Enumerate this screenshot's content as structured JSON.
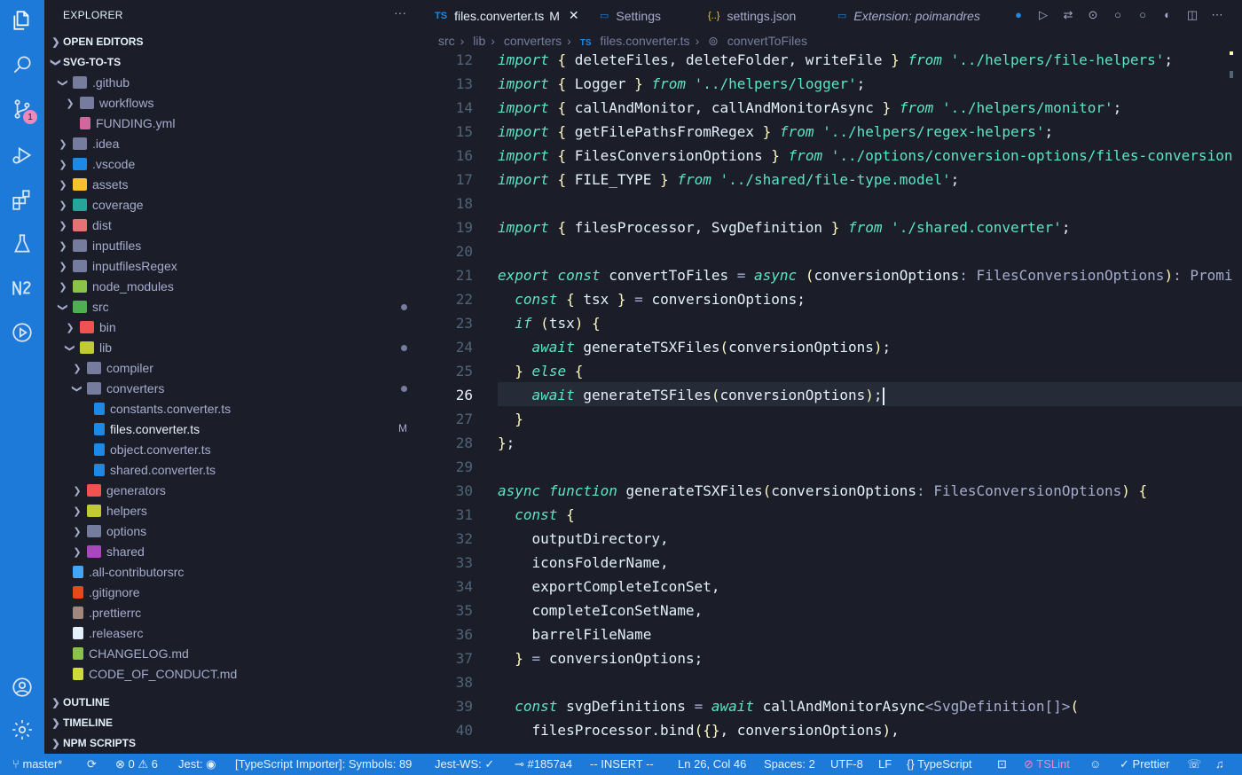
{
  "sidebar": {
    "title": "EXPLORER",
    "more": "···",
    "sections": {
      "open_editors": "OPEN EDITORS",
      "project": "SVG-TO-TS",
      "outline": "OUTLINE",
      "timeline": "TIMELINE",
      "npm": "NPM SCRIPTS"
    },
    "tree": [
      {
        "label": ".github",
        "depth": 1,
        "expanded": true,
        "color": "#767c9d"
      },
      {
        "label": "workflows",
        "depth": 2,
        "expanded": false,
        "color": "#767c9d"
      },
      {
        "label": "FUNDING.yml",
        "depth": 2,
        "file": true,
        "color": "#d0679d"
      },
      {
        "label": ".idea",
        "depth": 1,
        "expanded": false,
        "color": "#767c9d"
      },
      {
        "label": ".vscode",
        "depth": 1,
        "expanded": false,
        "color": "#1e88e5"
      },
      {
        "label": "assets",
        "depth": 1,
        "expanded": false,
        "color": "#fbc02d"
      },
      {
        "label": "coverage",
        "depth": 1,
        "expanded": false,
        "color": "#26a69a"
      },
      {
        "label": "dist",
        "depth": 1,
        "expanded": false,
        "color": "#e57373"
      },
      {
        "label": "inputfiles",
        "depth": 1,
        "expanded": false,
        "color": "#767c9d"
      },
      {
        "label": "inputfilesRegex",
        "depth": 1,
        "expanded": false,
        "color": "#767c9d"
      },
      {
        "label": "node_modules",
        "depth": 1,
        "expanded": false,
        "color": "#8bc34a"
      },
      {
        "label": "src",
        "depth": 1,
        "expanded": true,
        "color": "#4caf50",
        "dot": true
      },
      {
        "label": "bin",
        "depth": 2,
        "expanded": false,
        "color": "#ef5350"
      },
      {
        "label": "lib",
        "depth": 2,
        "expanded": true,
        "color": "#c0ca33",
        "dot": true
      },
      {
        "label": "compiler",
        "depth": 3,
        "expanded": false,
        "color": "#767c9d"
      },
      {
        "label": "converters",
        "depth": 3,
        "expanded": true,
        "color": "#767c9d",
        "dot": true
      },
      {
        "label": "constants.converter.ts",
        "depth": 4,
        "file": true,
        "color": "#1e88e5"
      },
      {
        "label": "files.converter.ts",
        "depth": 4,
        "file": true,
        "color": "#1e88e5",
        "active": true,
        "flag": "M"
      },
      {
        "label": "object.converter.ts",
        "depth": 4,
        "file": true,
        "color": "#1e88e5"
      },
      {
        "label": "shared.converter.ts",
        "depth": 4,
        "file": true,
        "color": "#1e88e5"
      },
      {
        "label": "generators",
        "depth": 3,
        "expanded": false,
        "color": "#ef5350"
      },
      {
        "label": "helpers",
        "depth": 3,
        "expanded": false,
        "color": "#c0ca33"
      },
      {
        "label": "options",
        "depth": 3,
        "expanded": false,
        "color": "#767c9d"
      },
      {
        "label": "shared",
        "depth": 3,
        "expanded": false,
        "color": "#ab47bc"
      },
      {
        "label": ".all-contributorsrc",
        "depth": 1,
        "file": true,
        "color": "#42a5f5"
      },
      {
        "label": ".gitignore",
        "depth": 1,
        "file": true,
        "color": "#e64a19"
      },
      {
        "label": ".prettierrc",
        "depth": 1,
        "file": true,
        "color": "#a1887f"
      },
      {
        "label": ".releaserc",
        "depth": 1,
        "file": true,
        "color": "#e4f0fb"
      },
      {
        "label": "CHANGELOG.md",
        "depth": 1,
        "file": true,
        "color": "#8bc34a"
      },
      {
        "label": "CODE_OF_CONDUCT.md",
        "depth": 1,
        "file": true,
        "color": "#cddc39"
      }
    ]
  },
  "tabs": [
    {
      "label": "files.converter.ts",
      "flag": "M",
      "icon": "TS",
      "active": true
    },
    {
      "label": "Settings",
      "icon": "settings-file-icon"
    },
    {
      "label": "settings.json",
      "icon": "{..}"
    },
    {
      "label": "Extension: poimandres",
      "icon": "extension-icon"
    }
  ],
  "breadcrumb": [
    "src",
    "lib",
    "converters",
    "files.converter.ts",
    "convertToFiles"
  ],
  "badge": "1",
  "editor": {
    "current_line": 26,
    "lines": [
      {
        "n": 12,
        "html": "<span class='kw'>import</span> <span class='p'>{</span> deleteFiles, deleteFolder, writeFile <span class='p'>}</span> <span class='kw'>from</span> <span class='str'>'../helpers/file-helpers'</span>;"
      },
      {
        "n": 13,
        "html": "<span class='kw'>import</span> <span class='p'>{</span> Logger <span class='p'>}</span> <span class='kw'>from</span> <span class='str'>'../helpers/logger'</span>;"
      },
      {
        "n": 14,
        "html": "<span class='kw'>import</span> <span class='p'>{</span> callAndMonitor, callAndMonitorAsync <span class='p'>}</span> <span class='kw'>from</span> <span class='str'>'../helpers/monitor'</span>;"
      },
      {
        "n": 15,
        "html": "<span class='kw'>import</span> <span class='p'>{</span> getFilePathsFromRegex <span class='p'>}</span> <span class='kw'>from</span> <span class='str'>'../helpers/regex-helpers'</span>;"
      },
      {
        "n": 16,
        "html": "<span class='kw'>import</span> <span class='p'>{</span> FilesConversionOptions <span class='p'>}</span> <span class='kw'>from</span> <span class='str'>'../options/conversion-options/files-conversion</span>"
      },
      {
        "n": 17,
        "html": "<span class='kw'>import</span> <span class='p'>{</span> FILE_TYPE <span class='p'>}</span> <span class='kw'>from</span> <span class='str'>'../shared/file-type.model'</span>;"
      },
      {
        "n": 18,
        "html": ""
      },
      {
        "n": 19,
        "html": "<span class='kw'>import</span> <span class='p'>{</span> filesProcessor, SvgDefinition <span class='p'>}</span> <span class='kw'>from</span> <span class='str'>'./shared.converter'</span>;"
      },
      {
        "n": 20,
        "html": ""
      },
      {
        "n": 21,
        "html": "<span class='kw'>export</span> <span class='kw'>const</span> convertToFiles <span class='ty'>=</span> <span class='kw'>async</span> <span class='p'>(</span>conversionOptions<span class='ty'>:</span> <span class='ty'>FilesConversionOptions</span><span class='p'>)</span><span class='ty'>:</span> <span class='ty'>Promi</span>"
      },
      {
        "n": 22,
        "html": "  <span class='kw'>const</span> <span class='p'>{</span> tsx <span class='p'>}</span> <span class='ty'>=</span> conversionOptions;"
      },
      {
        "n": 23,
        "html": "  <span class='kw'>if</span> <span class='p'>(</span>tsx<span class='p'>)</span> <span class='p'>{</span>"
      },
      {
        "n": 24,
        "html": "    <span class='kw'>await</span> generateTSXFiles<span class='p'>(</span>conversionOptions<span class='p'>)</span>;"
      },
      {
        "n": 25,
        "html": "  <span class='p'>}</span> <span class='kw'>else</span> <span class='p'>{</span>"
      },
      {
        "n": 26,
        "html": "    <span class='kw'>await</span> generateTSFiles<span class='p'>(</span>conversionOptions<span class='p'>)</span>;"
      },
      {
        "n": 27,
        "html": "  <span class='p'>}</span>"
      },
      {
        "n": 28,
        "html": "<span class='p'>}</span>;"
      },
      {
        "n": 29,
        "html": ""
      },
      {
        "n": 30,
        "html": "<span class='kw'>async</span> <span class='kw'>function</span> generateTSXFiles<span class='p'>(</span>conversionOptions<span class='ty'>:</span> <span class='ty'>FilesConversionOptions</span><span class='p'>)</span> <span class='p'>{</span>"
      },
      {
        "n": 31,
        "html": "  <span class='kw'>const</span> <span class='p'>{</span>"
      },
      {
        "n": 32,
        "html": "    outputDirectory,"
      },
      {
        "n": 33,
        "html": "    iconsFolderName,"
      },
      {
        "n": 34,
        "html": "    exportCompleteIconSet,"
      },
      {
        "n": 35,
        "html": "    completeIconSetName,"
      },
      {
        "n": 36,
        "html": "    barrelFileName"
      },
      {
        "n": 37,
        "html": "  <span class='p'>}</span> <span class='ty'>=</span> conversionOptions;"
      },
      {
        "n": 38,
        "html": ""
      },
      {
        "n": 39,
        "html": "  <span class='kw'>const</span> svgDefinitions <span class='ty'>=</span> <span class='kw'>await</span> callAndMonitorAsync<span class='ty'>&lt;SvgDefinition[]&gt;</span><span class='p'>(</span>"
      },
      {
        "n": 40,
        "html": "    filesProcessor.bind<span class='p'>({}</span>, conversionOptions<span class='p'>)</span>,"
      }
    ]
  },
  "status": {
    "branch": "master*",
    "errors": "0",
    "warnings": "6",
    "jest": "Jest:",
    "importer": "[TypeScript Importer]: Symbols: 89",
    "jest_ws": "Jest-WS: ✓",
    "commit": "#1857a4",
    "mode": "-- INSERT --",
    "position": "Ln 26, Col 46",
    "spaces": "Spaces: 2",
    "encoding": "UTF-8",
    "eol": "LF",
    "language": "TypeScript",
    "tslint": "TSLint",
    "prettier": "Prettier"
  },
  "colors": {
    "accent": "#1e7ad8",
    "background": "#1b1e28",
    "teal": "#5de4c7",
    "yellow": "#fffac2",
    "text": "#e4f0fb"
  }
}
